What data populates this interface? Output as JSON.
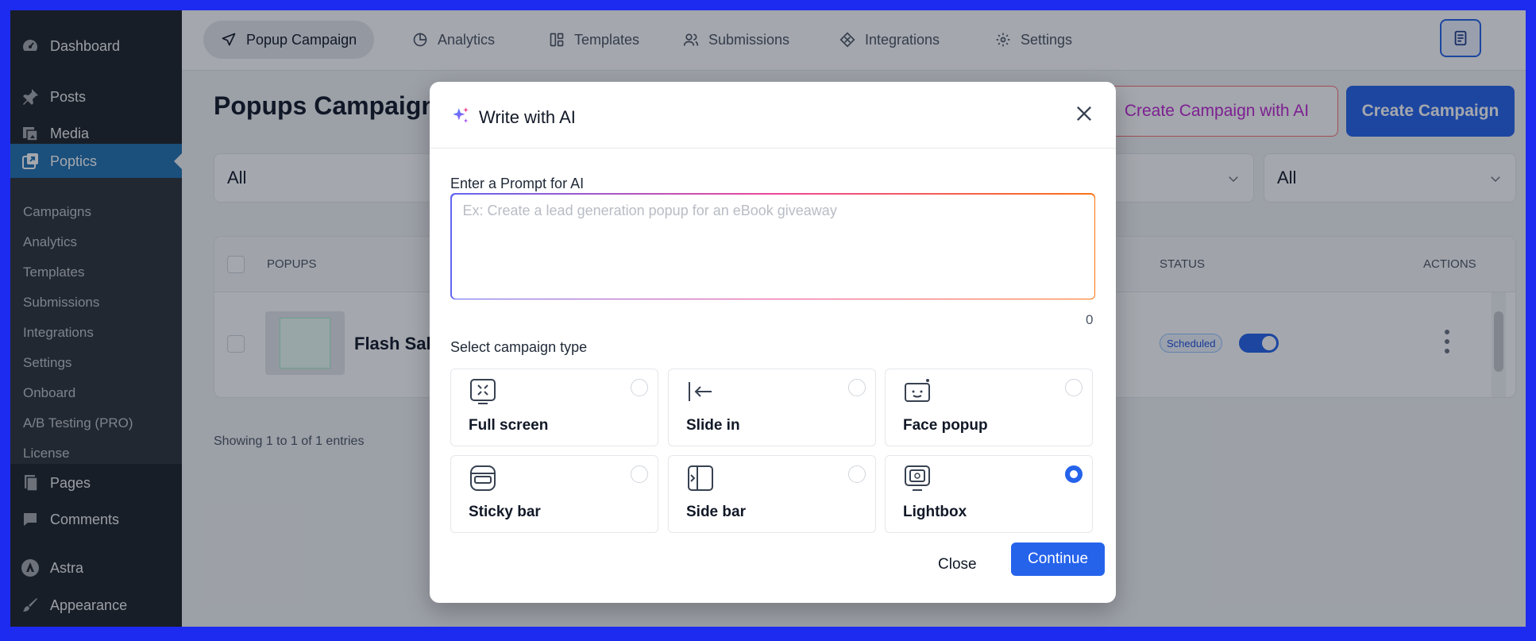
{
  "sidebar": {
    "menu": [
      {
        "label": "Dashboard",
        "icon": "dashboard-icon"
      },
      {
        "label": "Posts",
        "icon": "pin-icon"
      },
      {
        "label": "Media",
        "icon": "media-icon"
      },
      {
        "label": "Poptics",
        "icon": "poptics-icon"
      },
      {
        "label": "Pages",
        "icon": "pages-icon"
      },
      {
        "label": "Comments",
        "icon": "comments-icon"
      },
      {
        "label": "Astra",
        "icon": "astra-icon"
      },
      {
        "label": "Appearance",
        "icon": "brush-icon"
      }
    ],
    "submenu": [
      "Campaigns",
      "Analytics",
      "Templates",
      "Submissions",
      "Integrations",
      "Settings",
      "Onboard",
      "A/B Testing (PRO)",
      "License"
    ]
  },
  "topnav": {
    "tabs": [
      "Popup Campaign",
      "Analytics",
      "Templates",
      "Submissions",
      "Integrations",
      "Settings"
    ]
  },
  "page": {
    "title": "Popups Campaign",
    "ai_button": "Create Campaign with AI",
    "create_button": "Create Campaign",
    "filters": [
      "All",
      "All"
    ],
    "table": {
      "headers": {
        "popups": "POPUPS",
        "status": "STATUS",
        "actions": "ACTIONS"
      },
      "rows": [
        {
          "name": "Flash Sale",
          "status": "Scheduled"
        }
      ]
    },
    "showing": "Showing 1 to 1 of 1 entries"
  },
  "modal": {
    "title": "Write with AI",
    "prompt_label": "Enter a Prompt for AI",
    "prompt_placeholder": "Ex: Create a lead generation popup for an eBook giveaway",
    "prompt_value": "",
    "char_count": "0",
    "type_label": "Select campaign type",
    "types": [
      "Full screen",
      "Slide in",
      "Face popup",
      "Sticky bar",
      "Side bar",
      "Lightbox"
    ],
    "selected_type": "Lightbox",
    "close_button": "Close",
    "continue_button": "Continue"
  },
  "colors": {
    "accent": "#2563eb",
    "wp_sidebar": "#1d2327",
    "wp_active": "#2271b1",
    "frame": "#1d2bf0"
  }
}
